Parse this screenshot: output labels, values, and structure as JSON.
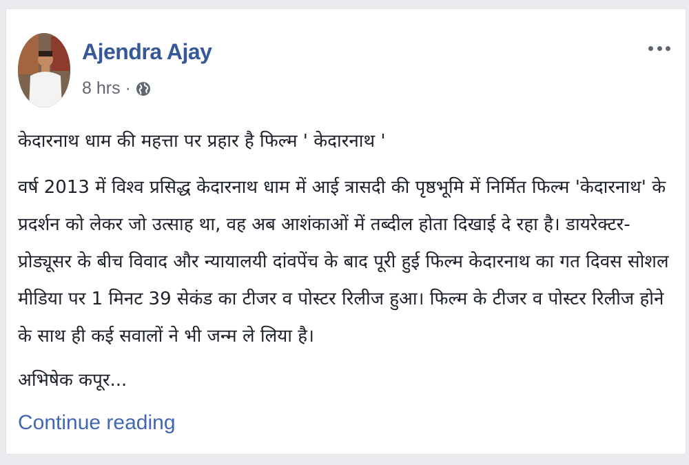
{
  "post": {
    "author": "Ajendra Ajay",
    "time": "8 hrs",
    "separator": "·",
    "privacy_icon": "globe-icon",
    "more_icon": "more-options-icon",
    "title": "केदारनाथ धाम की महत्ता पर प्रहार है फिल्म ' केदारनाथ '",
    "body": "वर्ष 2013 में विश्व प्रसिद्ध केदारनाथ धाम में आई त्रासदी की पृष्ठभूमि में निर्मित फिल्म 'केदारनाथ' के प्रदर्शन को लेकर जो उत्साह था, वह अब आशंकाओं में तब्दील होता दिखाई दे रहा है। डायरेक्टर-प्रोड्यूसर के बीच विवाद और न्यायालयी दांवपेंच के बाद पूरी हुई फिल्म केदारनाथ का गत दिवस सोशल मीडिया पर 1 मिनट 39 सेकंड का टीजर व पोस्टर रिलीज हुआ। फिल्म के टीजर व पोस्टर रिलीज होने के साथ ही कई सवालों ने भी जन्म ले लिया है।",
    "byline": "अभिषेक कपूर...",
    "continue_label": "Continue reading"
  },
  "colors": {
    "author": "#365899",
    "link": "#4267b2",
    "text": "#1d2129",
    "meta": "#616770",
    "background": "#e9ebee"
  }
}
